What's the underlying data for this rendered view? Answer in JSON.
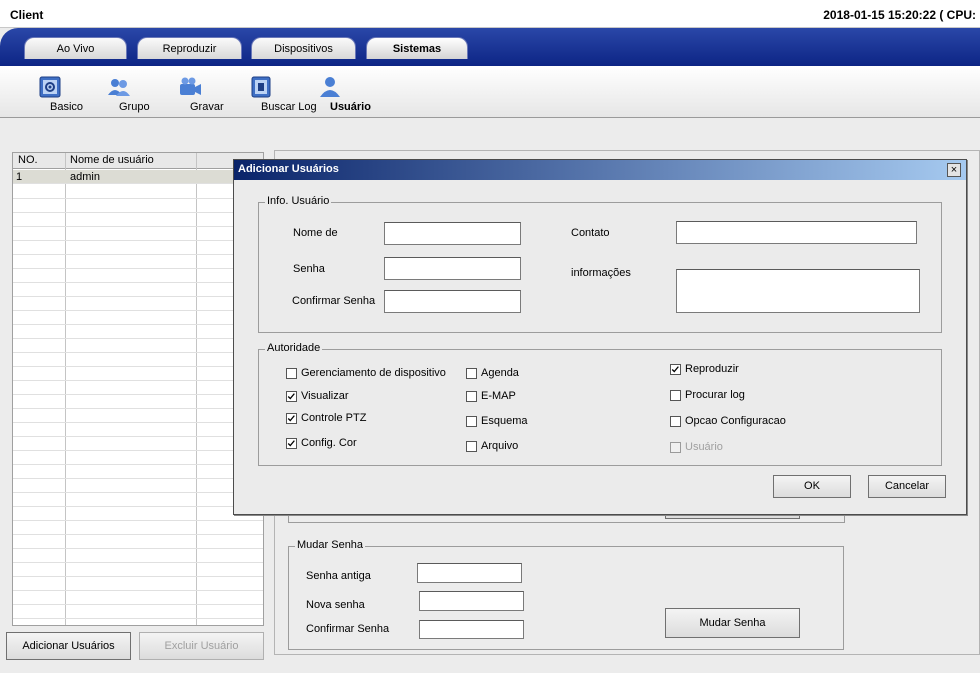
{
  "window": {
    "app_title": "Client",
    "clock": "2018-01-15 15:20:22 ( CPU:"
  },
  "tabs": [
    {
      "label": "Ao Vivo"
    },
    {
      "label": "Reproduzir"
    },
    {
      "label": "Dispositivos"
    },
    {
      "label": "Sistemas"
    }
  ],
  "toolbar": [
    {
      "label": "Basico",
      "icon": "settings-icon"
    },
    {
      "label": "Grupo",
      "icon": "group-icon"
    },
    {
      "label": "Gravar",
      "icon": "camera-icon"
    },
    {
      "label": "Buscar Log",
      "icon": "log-icon"
    },
    {
      "label": "Usuário",
      "icon": "user-icon"
    }
  ],
  "user_table": {
    "columns": [
      "NO.",
      "Nome de usuário"
    ],
    "rows": [
      {
        "no": "1",
        "name": "admin"
      }
    ]
  },
  "left_buttons": {
    "add": "Adicionar Usuários",
    "delete": "Excluir Usuário"
  },
  "change_password": {
    "legend": "Mudar Senha",
    "old_label": "Senha antiga",
    "new_label": "Nova senha",
    "confirm_label": "Confirmar Senha",
    "button": "Mudar Senha"
  },
  "dialog": {
    "title": "Adicionar Usuários",
    "close": "×",
    "info_legend": "Info. Usuário",
    "name_label": "Nome de",
    "password_label": "Senha",
    "confirm_label": "Confirmar Senha",
    "contact_label": "Contato",
    "info_label": "informações",
    "auth_legend": "Autoridade",
    "permissions": [
      {
        "label": "Gerenciamento de dispositivo",
        "checked": false,
        "enabled": true
      },
      {
        "label": "Visualizar",
        "checked": true,
        "enabled": true
      },
      {
        "label": "Controle PTZ",
        "checked": true,
        "enabled": true
      },
      {
        "label": "Config. Cor",
        "checked": true,
        "enabled": true
      },
      {
        "label": "Agenda",
        "checked": false,
        "enabled": true
      },
      {
        "label": "E-MAP",
        "checked": false,
        "enabled": true
      },
      {
        "label": "Esquema",
        "checked": false,
        "enabled": true
      },
      {
        "label": "Arquivo",
        "checked": false,
        "enabled": true
      },
      {
        "label": "Reproduzir",
        "checked": true,
        "enabled": true
      },
      {
        "label": "Procurar log",
        "checked": false,
        "enabled": true
      },
      {
        "label": "Opcao Configuracao",
        "checked": false,
        "enabled": true
      },
      {
        "label": "Usuário",
        "checked": false,
        "enabled": false
      }
    ],
    "ok": "OK",
    "cancel": "Cancelar"
  }
}
